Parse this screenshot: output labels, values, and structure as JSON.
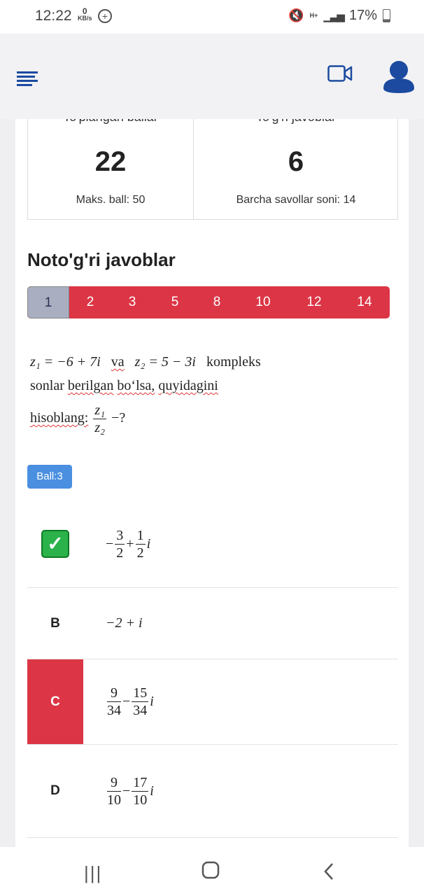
{
  "status_bar": {
    "time": "12:22",
    "net_speed_value": "0",
    "net_speed_unit": "KB/s",
    "network": "H+",
    "battery": "17%"
  },
  "stats": {
    "left_label": "To'plangan ballar",
    "left_value": "22",
    "left_sub": "Maks. ball: 50",
    "right_label": "To'g'ri javoblar",
    "right_value": "6",
    "right_sub": "Barcha savollar soni: 14"
  },
  "section_title": "Noto'g'ri javoblar",
  "question_nav": [
    "1",
    "2",
    "3",
    "5",
    "8",
    "10",
    "12",
    "14"
  ],
  "question": {
    "z1": "z₁ = −6 + 7i",
    "va": "va",
    "z2": "z₂ = 5 − 3i",
    "kompleks": "kompleks",
    "line2a": "sonlar",
    "line2b": "berilgan",
    "line2c": "bo‘lsa,",
    "line2d": "quyidagini",
    "line3": "hisoblang:",
    "frac_num": "z₁",
    "frac_den": "z₂",
    "tail": "−?"
  },
  "ball_badge": "Ball:3",
  "options": [
    {
      "key": "",
      "correct": true,
      "minus": "−",
      "n1": "3",
      "d1": "2",
      "op": "+",
      "n2": "1",
      "d2": "2",
      "suffix": "i"
    },
    {
      "key": "B",
      "text": "−2 + i"
    },
    {
      "key": "C",
      "wrong": true,
      "n1": "9",
      "d1": "34",
      "op": "−",
      "n2": "15",
      "d2": "34",
      "suffix": "i"
    },
    {
      "key": "D",
      "n1": "9",
      "d1": "10",
      "op": "−",
      "n2": "17",
      "d2": "10",
      "suffix": "i"
    }
  ],
  "icons": {
    "menu": "menu-icon",
    "video": "video-camera-icon",
    "user": "user-icon",
    "correct": "check-mark-icon"
  },
  "colors": {
    "danger": "#dc3545",
    "primary": "#1b4aa0",
    "badge": "#4a8fe0",
    "success": "#2cb24a"
  }
}
